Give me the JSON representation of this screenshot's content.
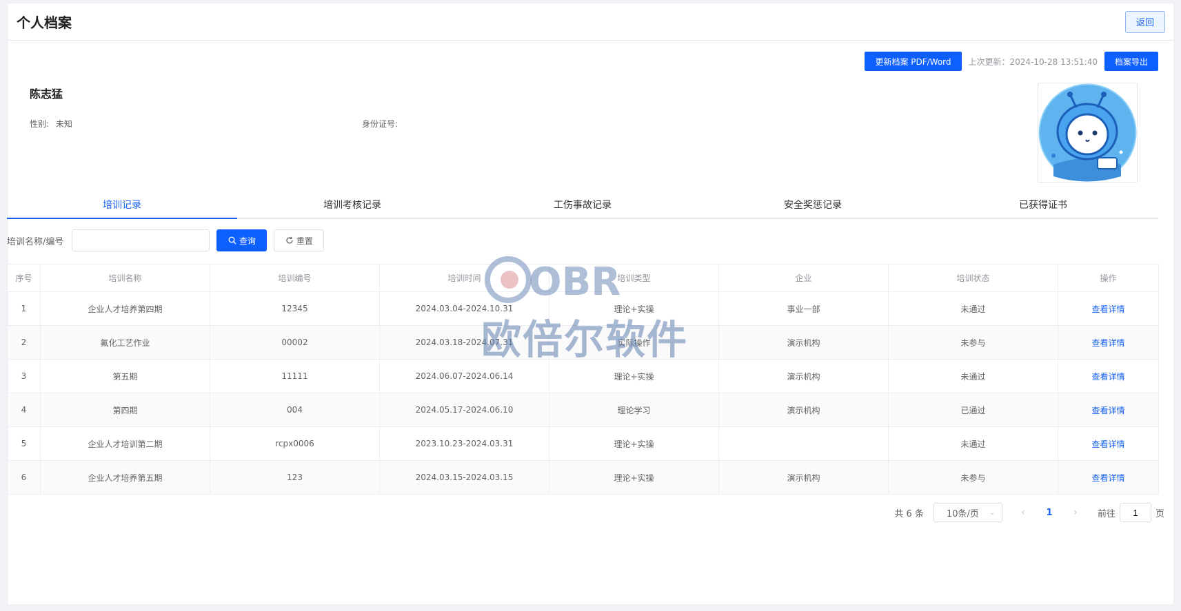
{
  "header": {
    "title": "个人档案",
    "back_label": "返回"
  },
  "topbar": {
    "update_btn": "更新档案 PDF/Word",
    "last_update": "上次更新：2024-10-28 13:51:40",
    "export_btn": "档案导出"
  },
  "profile": {
    "name": "陈志猛",
    "gender_label": "性别:",
    "gender_value": "未知",
    "id_label": "身份证号:",
    "id_value": ""
  },
  "tabs": [
    "培训记录",
    "培训考核记录",
    "工伤事故记录",
    "安全奖惩记录",
    "已获得证书"
  ],
  "active_tab": 0,
  "search": {
    "label": "培训名称/编号",
    "value": "",
    "placeholder": "",
    "query_label": "查询",
    "reset_label": "重置"
  },
  "table": {
    "columns": [
      "序号",
      "培训名称",
      "培训编号",
      "培训时间",
      "培训类型",
      "企业",
      "培训状态",
      "操作"
    ],
    "rows": [
      [
        "1",
        "企业人才培养第四期",
        "12345",
        "2024.03.04-2024.10.31",
        "理论+实操",
        "事业一部",
        "未通过",
        "查看详情"
      ],
      [
        "2",
        "氟化工艺作业",
        "00002",
        "2024.03.18-2024.07.31",
        "实际操作",
        "演示机构",
        "未参与",
        "查看详情"
      ],
      [
        "3",
        "第五期",
        "11111",
        "2024.06.07-2024.06.14",
        "理论+实操",
        "演示机构",
        "未通过",
        "查看详情"
      ],
      [
        "4",
        "第四期",
        "004",
        "2024.05.17-2024.06.10",
        "理论学习",
        "演示机构",
        "已通过",
        "查看详情"
      ],
      [
        "5",
        "企业人才培训第二期",
        "rcpx0006",
        "2023.10.23-2024.03.31",
        "理论+实操",
        "",
        "未通过",
        "查看详情"
      ],
      [
        "6",
        "企业人才培养第五期",
        "123",
        "2024.03.15-2024.03.15",
        "理论+实操",
        "演示机构",
        "未参与",
        "查看详情"
      ]
    ]
  },
  "pagination": {
    "total": "共 6 条",
    "page_size": "10条/页",
    "current": "1",
    "jump_label": "前往",
    "jump_value": "1",
    "jump_suffix": "页"
  },
  "watermark": {
    "logo": "OBR",
    "text": "欧倍尔软件"
  }
}
